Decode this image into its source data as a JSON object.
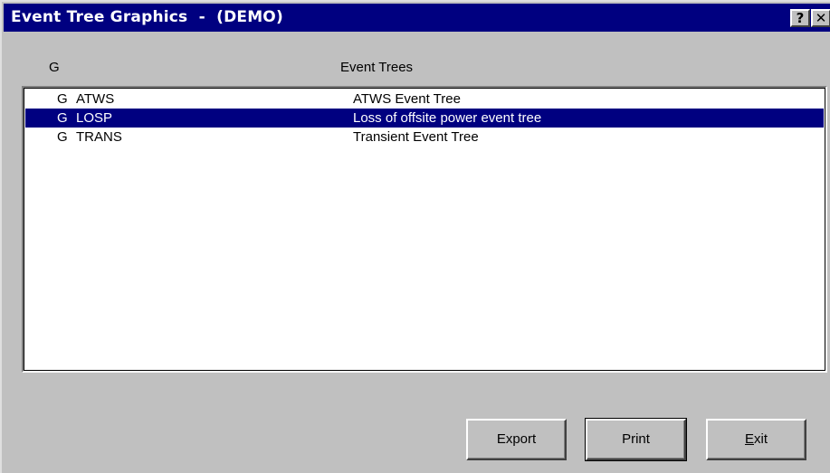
{
  "window": {
    "title": "Event Tree Graphics  -  (DEMO)",
    "help_glyph": "?",
    "close_glyph": "✕"
  },
  "columns": {
    "g": "G",
    "event_trees": "Event Trees"
  },
  "rows": [
    {
      "g": "G",
      "name": "ATWS",
      "description": "ATWS Event Tree",
      "selected": false
    },
    {
      "g": "G",
      "name": "LOSP",
      "description": "Loss of offsite power event tree",
      "selected": true
    },
    {
      "g": "G",
      "name": "TRANS",
      "description": "Transient Event Tree",
      "selected": false
    }
  ],
  "buttons": {
    "export": "Export",
    "print": "Print",
    "exit_first": "E",
    "exit_rest": "xit"
  },
  "colors": {
    "titlebar": "#000080",
    "selection": "#000080",
    "face": "#c0c0c0"
  }
}
